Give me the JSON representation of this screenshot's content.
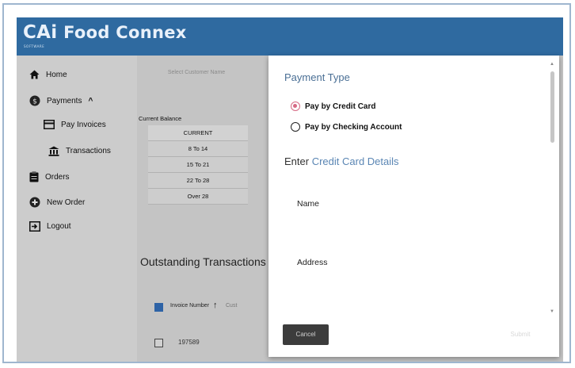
{
  "app": {
    "brand_prefix": "CAi",
    "brand_name": "Food Connex",
    "brand_tagline": "SOFTWARE"
  },
  "sidebar": {
    "items": [
      {
        "label": "Home",
        "icon": "home-icon"
      },
      {
        "label": "Payments",
        "icon": "dollar-circle-icon",
        "expanded_indicator": "^"
      },
      {
        "label": "Pay Invoices",
        "icon": "credit-card-icon"
      },
      {
        "label": "Transactions",
        "icon": "bank-icon"
      },
      {
        "label": "Orders",
        "icon": "clipboard-icon"
      },
      {
        "label": "New Order",
        "icon": "plus-circle-icon"
      },
      {
        "label": "Logout",
        "icon": "logout-icon"
      }
    ]
  },
  "main": {
    "customer_select_placeholder": "Select Customer Name",
    "current_balance_label": "Current Balance",
    "aging_buckets": [
      "CURRENT",
      "8 To 14",
      "15 To 21",
      "22 To 28",
      "Over 28"
    ],
    "outstanding_title": "Outstanding Transactions",
    "table": {
      "col_invoice": "Invoice Number",
      "sort_arrow": "↑",
      "col_customer": "Cust",
      "rows": [
        {
          "invoice": "197589"
        }
      ]
    }
  },
  "modal": {
    "payment_type_title": "Payment Type",
    "options": [
      {
        "label": "Pay by Credit Card",
        "selected": true
      },
      {
        "label": "Pay by Checking Account",
        "selected": false
      }
    ],
    "section_prefix": "Enter",
    "section_accent": "Credit Card Details",
    "fields": {
      "name_label": "Name",
      "address_label": "Address"
    },
    "cancel_label": "Cancel",
    "submit_label": "Submit"
  },
  "colors": {
    "topbar": "#2f6aa0",
    "radio_selected": "#d66a85",
    "title_text": "#4a6f95"
  }
}
